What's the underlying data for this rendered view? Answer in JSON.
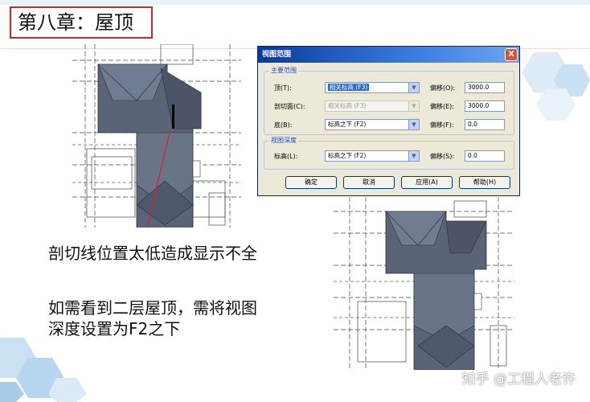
{
  "slide": {
    "title": "第八章：屋顶",
    "note1": "剖切线位置太低造成显示不全",
    "note2_line1": "如需看到二层屋顶，需将视图",
    "note2_line2": "深度设置为F2之下",
    "watermark": "知乎 @工程人老许"
  },
  "dialog": {
    "title": "视图范围",
    "close": "X",
    "primary_group": "主要范围",
    "depth_group": "视图深度",
    "rows": {
      "top": {
        "label": "顶(T):",
        "value": "相关标高 (F3)",
        "offset_label": "偏移(O):",
        "offset": "3000.0"
      },
      "cut": {
        "label": "剖切面(C):",
        "value": "相关标高 (F3)",
        "offset_label": "偏移(E):",
        "offset": "3000.0"
      },
      "bottom": {
        "label": "底(B):",
        "value": "标高之下 (F2)",
        "offset_label": "偏移(F):",
        "offset": "0.0"
      },
      "level": {
        "label": "标高(L):",
        "value": "标高之下 (F2)",
        "offset_label": "偏移(S):",
        "offset": "0.0"
      }
    },
    "buttons": {
      "ok": "确定",
      "cancel": "取消",
      "apply": "应用(A)",
      "help": "帮助(H)"
    }
  },
  "colors": {
    "title_border": "#d0272d",
    "roof": "#5a6478",
    "section_line": "#d0272d",
    "dialog_title": "#0a3a9a"
  }
}
